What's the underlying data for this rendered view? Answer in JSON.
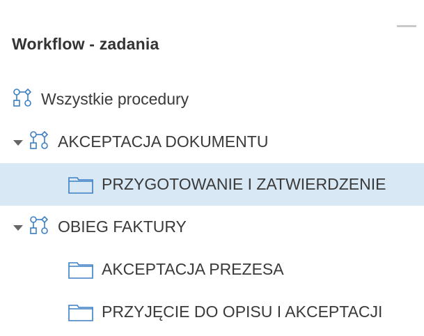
{
  "panel": {
    "title": "Workflow - zadania"
  },
  "tree": {
    "all_procedures": "Wszystkie procedury",
    "groups": [
      {
        "label": "AKCEPTACJA DOKUMENTU",
        "items": [
          {
            "label": "PRZYGOTOWANIE I ZATWIERDZENIE",
            "selected": true
          }
        ]
      },
      {
        "label": "OBIEG FAKTURY",
        "items": [
          {
            "label": "AKCEPTACJA PREZESA",
            "selected": false
          },
          {
            "label": "PRZYJĘCIE DO OPISU I AKCEPTACJI",
            "selected": false
          }
        ]
      }
    ]
  },
  "icons": {
    "minimize": "minimize-icon",
    "workflow": "workflow-icon",
    "folder": "folder-icon",
    "expand": "caret-down-icon"
  },
  "colors": {
    "icon_blue": "#3b7fc4",
    "selected_bg": "#d8e8f4",
    "text": "#3a3a3a"
  }
}
